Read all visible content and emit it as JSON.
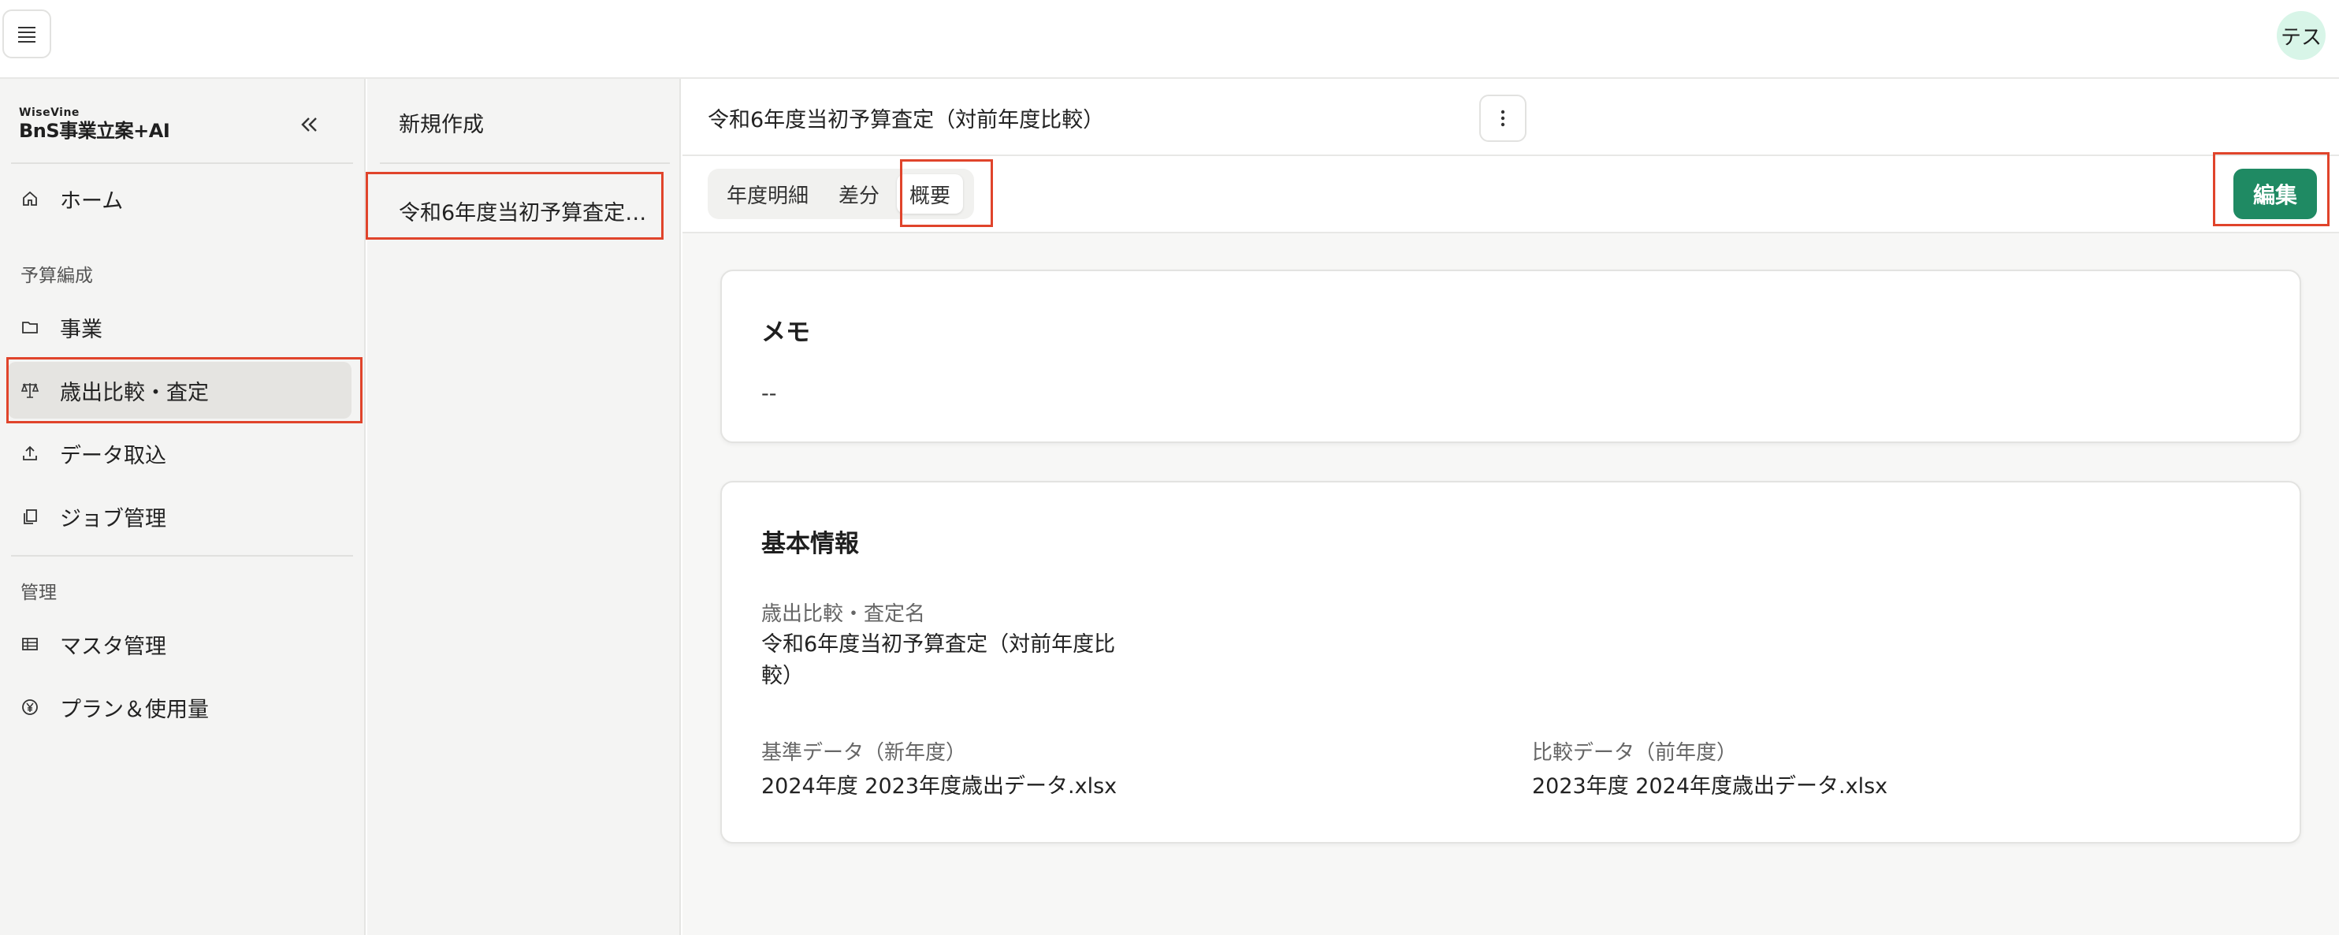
{
  "app": {
    "logo_small": "WiseVine",
    "logo_main": "BnS事業立案+AI",
    "avatar_text": "テス"
  },
  "sidebar": {
    "home": "ホーム",
    "section_budget": "予算編成",
    "items_budget": [
      "事業",
      "歳出比較・査定",
      "データ取込",
      "ジョブ管理"
    ],
    "section_admin": "管理",
    "items_admin": [
      "マスタ管理",
      "プラン＆使用量"
    ]
  },
  "list_panel": {
    "new_label": "新規作成",
    "item": "令和6年度当初予算査定（対前年度比較）"
  },
  "main": {
    "title": "令和6年度当初予算査定（対前年度比較）",
    "tabs": [
      "年度明細",
      "差分",
      "概要"
    ],
    "active_tab": "概要",
    "edit_label": "編集"
  },
  "memo": {
    "title": "メモ",
    "value": "--"
  },
  "basic_info": {
    "title": "基本情報",
    "name_label": "歳出比較・査定名",
    "name_value": "令和6年度当初予算査定（対前年度比較）",
    "base_label": "基準データ（新年度）",
    "base_value": "2024年度 2023年度歳出データ.xlsx",
    "compare_label": "比較データ（前年度）",
    "compare_value": "2023年度 2024年度歳出データ.xlsx"
  },
  "colors": {
    "accent_green": "#1f8a63",
    "highlight_red": "#e0442b",
    "avatar_bg": "#d8f5e8"
  }
}
